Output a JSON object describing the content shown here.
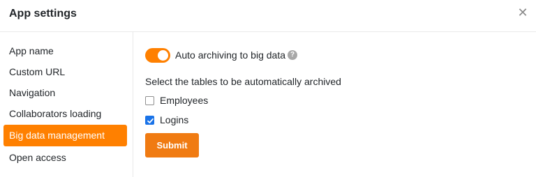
{
  "dialog": {
    "title": "App settings",
    "close_icon": "close-icon"
  },
  "sidebar": {
    "items": [
      {
        "label": "App name",
        "active": false
      },
      {
        "label": "Custom URL",
        "active": false
      },
      {
        "label": "Navigation",
        "active": false
      },
      {
        "label": "Collaborators loading",
        "active": false
      },
      {
        "label": "Big data management",
        "active": true
      },
      {
        "label": "Open access",
        "active": false
      }
    ]
  },
  "main": {
    "toggle": {
      "label": "Auto archiving to big data",
      "on": true,
      "help_icon": "question-circle-icon"
    },
    "select_label": "Select the tables to be automatically archived",
    "tables": [
      {
        "label": "Employees",
        "checked": false
      },
      {
        "label": "Logins",
        "checked": true
      }
    ],
    "submit_label": "Submit"
  },
  "colors": {
    "accent": "#ff8000",
    "checkbox_checked": "#1a73e8"
  }
}
